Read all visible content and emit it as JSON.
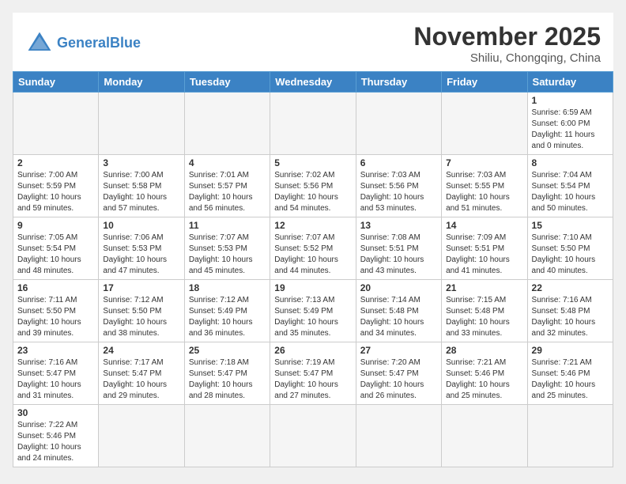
{
  "header": {
    "logo_general": "General",
    "logo_blue": "Blue",
    "month_title": "November 2025",
    "location": "Shiliu, Chongqing, China"
  },
  "weekdays": [
    "Sunday",
    "Monday",
    "Tuesday",
    "Wednesday",
    "Thursday",
    "Friday",
    "Saturday"
  ],
  "weeks": [
    [
      {
        "day": "",
        "info": ""
      },
      {
        "day": "",
        "info": ""
      },
      {
        "day": "",
        "info": ""
      },
      {
        "day": "",
        "info": ""
      },
      {
        "day": "",
        "info": ""
      },
      {
        "day": "",
        "info": ""
      },
      {
        "day": "1",
        "info": "Sunrise: 6:59 AM\nSunset: 6:00 PM\nDaylight: 11 hours\nand 0 minutes."
      }
    ],
    [
      {
        "day": "2",
        "info": "Sunrise: 7:00 AM\nSunset: 5:59 PM\nDaylight: 10 hours\nand 59 minutes."
      },
      {
        "day": "3",
        "info": "Sunrise: 7:00 AM\nSunset: 5:58 PM\nDaylight: 10 hours\nand 57 minutes."
      },
      {
        "day": "4",
        "info": "Sunrise: 7:01 AM\nSunset: 5:57 PM\nDaylight: 10 hours\nand 56 minutes."
      },
      {
        "day": "5",
        "info": "Sunrise: 7:02 AM\nSunset: 5:56 PM\nDaylight: 10 hours\nand 54 minutes."
      },
      {
        "day": "6",
        "info": "Sunrise: 7:03 AM\nSunset: 5:56 PM\nDaylight: 10 hours\nand 53 minutes."
      },
      {
        "day": "7",
        "info": "Sunrise: 7:03 AM\nSunset: 5:55 PM\nDaylight: 10 hours\nand 51 minutes."
      },
      {
        "day": "8",
        "info": "Sunrise: 7:04 AM\nSunset: 5:54 PM\nDaylight: 10 hours\nand 50 minutes."
      }
    ],
    [
      {
        "day": "9",
        "info": "Sunrise: 7:05 AM\nSunset: 5:54 PM\nDaylight: 10 hours\nand 48 minutes."
      },
      {
        "day": "10",
        "info": "Sunrise: 7:06 AM\nSunset: 5:53 PM\nDaylight: 10 hours\nand 47 minutes."
      },
      {
        "day": "11",
        "info": "Sunrise: 7:07 AM\nSunset: 5:53 PM\nDaylight: 10 hours\nand 45 minutes."
      },
      {
        "day": "12",
        "info": "Sunrise: 7:07 AM\nSunset: 5:52 PM\nDaylight: 10 hours\nand 44 minutes."
      },
      {
        "day": "13",
        "info": "Sunrise: 7:08 AM\nSunset: 5:51 PM\nDaylight: 10 hours\nand 43 minutes."
      },
      {
        "day": "14",
        "info": "Sunrise: 7:09 AM\nSunset: 5:51 PM\nDaylight: 10 hours\nand 41 minutes."
      },
      {
        "day": "15",
        "info": "Sunrise: 7:10 AM\nSunset: 5:50 PM\nDaylight: 10 hours\nand 40 minutes."
      }
    ],
    [
      {
        "day": "16",
        "info": "Sunrise: 7:11 AM\nSunset: 5:50 PM\nDaylight: 10 hours\nand 39 minutes."
      },
      {
        "day": "17",
        "info": "Sunrise: 7:12 AM\nSunset: 5:50 PM\nDaylight: 10 hours\nand 38 minutes."
      },
      {
        "day": "18",
        "info": "Sunrise: 7:12 AM\nSunset: 5:49 PM\nDaylight: 10 hours\nand 36 minutes."
      },
      {
        "day": "19",
        "info": "Sunrise: 7:13 AM\nSunset: 5:49 PM\nDaylight: 10 hours\nand 35 minutes."
      },
      {
        "day": "20",
        "info": "Sunrise: 7:14 AM\nSunset: 5:48 PM\nDaylight: 10 hours\nand 34 minutes."
      },
      {
        "day": "21",
        "info": "Sunrise: 7:15 AM\nSunset: 5:48 PM\nDaylight: 10 hours\nand 33 minutes."
      },
      {
        "day": "22",
        "info": "Sunrise: 7:16 AM\nSunset: 5:48 PM\nDaylight: 10 hours\nand 32 minutes."
      }
    ],
    [
      {
        "day": "23",
        "info": "Sunrise: 7:16 AM\nSunset: 5:47 PM\nDaylight: 10 hours\nand 31 minutes."
      },
      {
        "day": "24",
        "info": "Sunrise: 7:17 AM\nSunset: 5:47 PM\nDaylight: 10 hours\nand 29 minutes."
      },
      {
        "day": "25",
        "info": "Sunrise: 7:18 AM\nSunset: 5:47 PM\nDaylight: 10 hours\nand 28 minutes."
      },
      {
        "day": "26",
        "info": "Sunrise: 7:19 AM\nSunset: 5:47 PM\nDaylight: 10 hours\nand 27 minutes."
      },
      {
        "day": "27",
        "info": "Sunrise: 7:20 AM\nSunset: 5:47 PM\nDaylight: 10 hours\nand 26 minutes."
      },
      {
        "day": "28",
        "info": "Sunrise: 7:21 AM\nSunset: 5:46 PM\nDaylight: 10 hours\nand 25 minutes."
      },
      {
        "day": "29",
        "info": "Sunrise: 7:21 AM\nSunset: 5:46 PM\nDaylight: 10 hours\nand 25 minutes."
      }
    ],
    [
      {
        "day": "30",
        "info": "Sunrise: 7:22 AM\nSunset: 5:46 PM\nDaylight: 10 hours\nand 24 minutes."
      },
      {
        "day": "",
        "info": ""
      },
      {
        "day": "",
        "info": ""
      },
      {
        "day": "",
        "info": ""
      },
      {
        "day": "",
        "info": ""
      },
      {
        "day": "",
        "info": ""
      },
      {
        "day": "",
        "info": ""
      }
    ]
  ]
}
